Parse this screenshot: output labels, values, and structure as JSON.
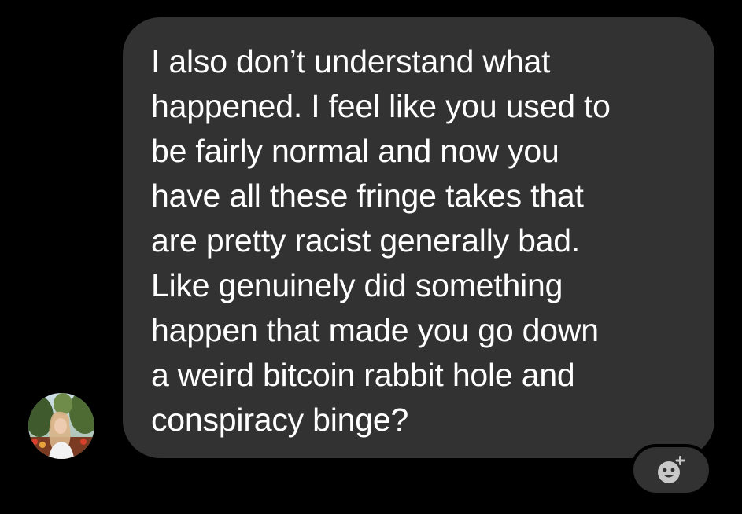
{
  "message": {
    "text": "I also don’t understand what\nhappened. I feel like you used to\nbe fairly normal and now you\nhave all these fringe takes that\nare pretty racist generally bad.\nLike genuinely did something\nhappen that made you go down\na weird bitcoin rabbit hole and\nconspiracy binge?"
  },
  "sender": {
    "avatar_icon": "profile-photo"
  },
  "reaction": {
    "icon": "add-reaction-smiley-icon"
  },
  "colors": {
    "background": "#000000",
    "bubble": "#323232",
    "text": "#ffffff",
    "icon": "#c8c8c8"
  }
}
